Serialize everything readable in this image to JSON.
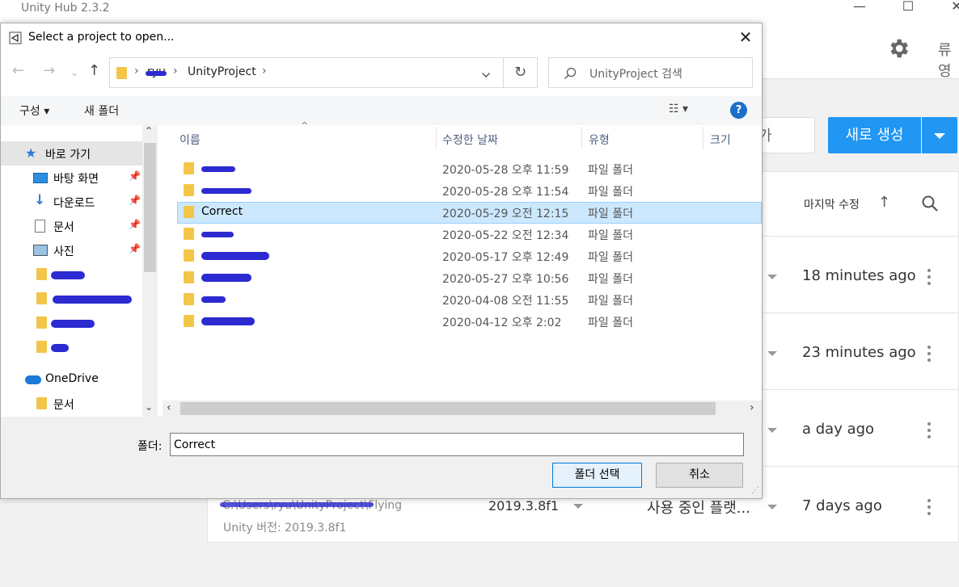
{
  "hub": {
    "title": "Unity Hub 2.3.2",
    "user_initial": "류영",
    "add_label": "가",
    "new_button": "새로 생성",
    "sort_label": "마지막 수정",
    "rows": [
      {
        "time": "18 minutes ago"
      },
      {
        "time": "23 minutes ago"
      },
      {
        "time": "a day ago"
      },
      {
        "time": "7 days ago",
        "path": "C:\\Users\\ryu\\UnityProject\\Flying",
        "version_label": "Unity 버전: 2019.3.8f1",
        "version_select": "2019.3.8f1",
        "platform": "사용 중인 플랫..."
      }
    ]
  },
  "dialog": {
    "title": "Select a project to open...",
    "address": {
      "segment1": "ryu",
      "segment2": "UnityProject"
    },
    "search_placeholder": "UnityProject 검색",
    "organize": "구성 ▾",
    "new_folder": "새 폴더",
    "view_icon": "☷ ▾",
    "help": "?",
    "nav": [
      {
        "label": "바로 가기"
      },
      {
        "label": "바탕 화면"
      },
      {
        "label": "다운로드"
      },
      {
        "label": "문서"
      },
      {
        "label": "사진"
      },
      {
        "label": "OneDrive"
      },
      {
        "label": "문서"
      }
    ],
    "columns": {
      "name": "이름",
      "date": "수정한 날짜",
      "type": "유형",
      "size": "크기"
    },
    "files": [
      {
        "name": "",
        "date": "2020-05-28 오후 11:59",
        "type": "파일 폴더"
      },
      {
        "name": "",
        "date": "2020-05-28 오후 11:54",
        "type": "파일 폴더"
      },
      {
        "name": "Correct",
        "date": "2020-05-29 오전 12:15",
        "type": "파일 폴더"
      },
      {
        "name": "",
        "date": "2020-05-22 오전 12:34",
        "type": "파일 폴더"
      },
      {
        "name": "",
        "date": "2020-05-17 오후 12:49",
        "type": "파일 폴더"
      },
      {
        "name": "",
        "date": "2020-05-27 오후 10:56",
        "type": "파일 폴더"
      },
      {
        "name": "",
        "date": "2020-04-08 오전 11:55",
        "type": "파일 폴더"
      },
      {
        "name": "",
        "date": "2020-04-12 오후 2:02",
        "type": "파일 폴더"
      }
    ],
    "folder_label": "폴더:",
    "folder_value": "Correct",
    "select_button": "폴더 선택",
    "cancel_button": "취소"
  },
  "colors": {
    "accent": "#2196f3",
    "selection": "#cce8ff",
    "redaction": "#2c2ad1"
  }
}
